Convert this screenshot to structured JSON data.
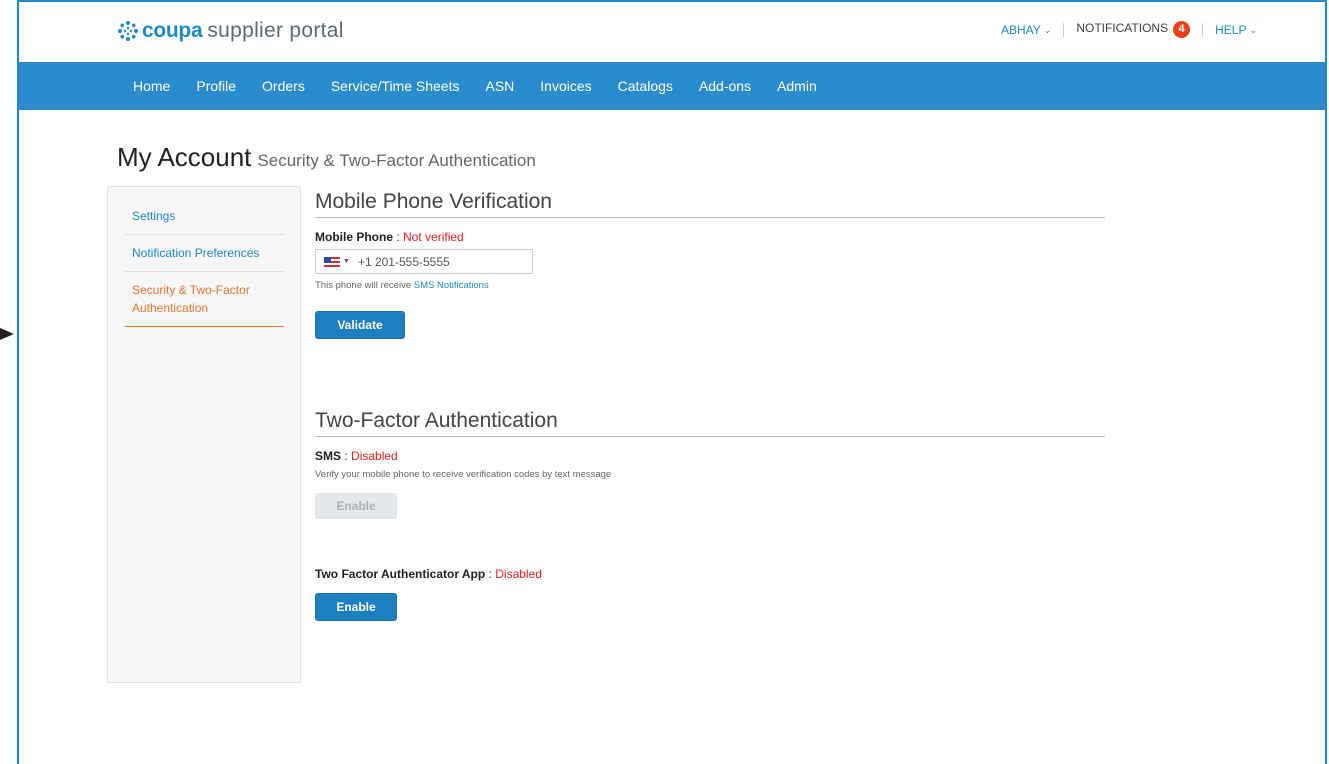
{
  "brand": {
    "name_bold": "coupa",
    "name_rest": "supplier portal",
    "color": "#1e88c8"
  },
  "topbar": {
    "user_label": "ABHAY",
    "notifications_label": "NOTIFICATIONS",
    "notifications_count": "4",
    "help_label": "HELP"
  },
  "nav": {
    "items": [
      "Home",
      "Profile",
      "Orders",
      "Service/Time Sheets",
      "ASN",
      "Invoices",
      "Catalogs",
      "Add-ons",
      "Admin"
    ]
  },
  "page": {
    "title": "My Account",
    "subtitle": "Security & Two-Factor Authentication"
  },
  "sidebar": {
    "items": [
      {
        "label": "Settings"
      },
      {
        "label": "Notification Preferences"
      },
      {
        "label": "Security & Two-Factor Authentication",
        "active": true
      }
    ]
  },
  "mobile": {
    "section_title": "Mobile Phone Verification",
    "label": "Mobile Phone",
    "separator": " : ",
    "status": "Not verified",
    "phone_value": "+1 201-555-5555",
    "hint_prefix": "This phone will receive ",
    "hint_link": "SMS Notifications",
    "validate_label": "Validate"
  },
  "twofa": {
    "section_title": "Two-Factor Authentication",
    "sms_label": "SMS",
    "sms_separator": " : ",
    "sms_status": "Disabled",
    "sms_desc": "Verify your mobile phone to receive verification codes by text message",
    "sms_enable_label": "Enable",
    "app_label": "Two Factor Authenticator App",
    "app_separator": " : ",
    "app_status": "Disabled",
    "app_enable_label": "Enable"
  },
  "colors": {
    "nav_bg": "#2a8ccd",
    "accent": "#1e88c8",
    "active_orange": "#e87630",
    "status_red": "#e41e1e",
    "badge": "#e8401c"
  }
}
